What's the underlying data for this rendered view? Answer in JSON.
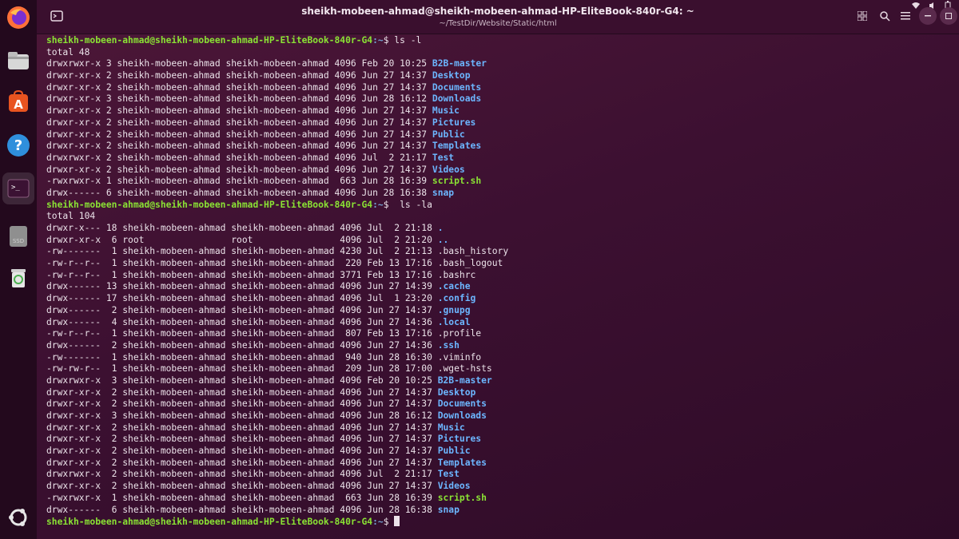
{
  "window": {
    "title": "sheikh-mobeen-ahmad@sheikh-mobeen-ahmad-HP-EliteBook-840r-G4: ~",
    "subtitle": "~/TestDir/Website/Static/html"
  },
  "dock": {
    "items": [
      {
        "name": "firefox-icon"
      },
      {
        "name": "files-icon"
      },
      {
        "name": "software-icon"
      },
      {
        "name": "help-icon"
      },
      {
        "name": "terminal-icon"
      },
      {
        "name": "drive-icon",
        "label": "SSD"
      },
      {
        "name": "trash-icon"
      },
      {
        "name": "ubuntu-logo-icon"
      }
    ]
  },
  "colors": {
    "prompt_user": "#8ae234",
    "prompt_path": "#729fcf",
    "directory": "#6cb6ff",
    "executable": "#8ae234",
    "text": "#ece3ea",
    "background": "#3c1031"
  },
  "terminal": {
    "prompt_user": "sheikh-mobeen-ahmad@sheikh-mobeen-ahmad-HP-EliteBook-840r-G4",
    "prompt_path": ":~",
    "commands": [
      {
        "command": "$ ls -l",
        "total": "total 48",
        "entries": [
          {
            "meta": "drwxrwxr-x 3 sheikh-mobeen-ahmad sheikh-mobeen-ahmad 4096 Feb 20 10:25 ",
            "name": "B2B-master",
            "kind": "dir"
          },
          {
            "meta": "drwxr-xr-x 2 sheikh-mobeen-ahmad sheikh-mobeen-ahmad 4096 Jun 27 14:37 ",
            "name": "Desktop",
            "kind": "dir"
          },
          {
            "meta": "drwxr-xr-x 2 sheikh-mobeen-ahmad sheikh-mobeen-ahmad 4096 Jun 27 14:37 ",
            "name": "Documents",
            "kind": "dir"
          },
          {
            "meta": "drwxr-xr-x 3 sheikh-mobeen-ahmad sheikh-mobeen-ahmad 4096 Jun 28 16:12 ",
            "name": "Downloads",
            "kind": "dir"
          },
          {
            "meta": "drwxr-xr-x 2 sheikh-mobeen-ahmad sheikh-mobeen-ahmad 4096 Jun 27 14:37 ",
            "name": "Music",
            "kind": "dir"
          },
          {
            "meta": "drwxr-xr-x 2 sheikh-mobeen-ahmad sheikh-mobeen-ahmad 4096 Jun 27 14:37 ",
            "name": "Pictures",
            "kind": "dir"
          },
          {
            "meta": "drwxr-xr-x 2 sheikh-mobeen-ahmad sheikh-mobeen-ahmad 4096 Jun 27 14:37 ",
            "name": "Public",
            "kind": "dir"
          },
          {
            "meta": "drwxr-xr-x 2 sheikh-mobeen-ahmad sheikh-mobeen-ahmad 4096 Jun 27 14:37 ",
            "name": "Templates",
            "kind": "dir"
          },
          {
            "meta": "drwxrwxr-x 2 sheikh-mobeen-ahmad sheikh-mobeen-ahmad 4096 Jul  2 21:17 ",
            "name": "Test",
            "kind": "dir"
          },
          {
            "meta": "drwxr-xr-x 2 sheikh-mobeen-ahmad sheikh-mobeen-ahmad 4096 Jun 27 14:37 ",
            "name": "Videos",
            "kind": "dir"
          },
          {
            "meta": "-rwxrwxr-x 1 sheikh-mobeen-ahmad sheikh-mobeen-ahmad  663 Jun 28 16:39 ",
            "name": "script.sh",
            "kind": "exec"
          },
          {
            "meta": "drwx------ 6 sheikh-mobeen-ahmad sheikh-mobeen-ahmad 4096 Jun 28 16:38 ",
            "name": "snap",
            "kind": "dir"
          }
        ]
      },
      {
        "command": "$  ls -la",
        "total": "total 104",
        "entries": [
          {
            "meta": "drwxr-x--- 18 sheikh-mobeen-ahmad sheikh-mobeen-ahmad 4096 Jul  2 21:18 ",
            "name": ".",
            "kind": "dir"
          },
          {
            "meta": "drwxr-xr-x  6 root                root                4096 Jul  2 21:20 ",
            "name": "..",
            "kind": "dir"
          },
          {
            "meta": "-rw-------  1 sheikh-mobeen-ahmad sheikh-mobeen-ahmad 4230 Jul  2 21:13 ",
            "name": ".bash_history",
            "kind": "file"
          },
          {
            "meta": "-rw-r--r--  1 sheikh-mobeen-ahmad sheikh-mobeen-ahmad  220 Feb 13 17:16 ",
            "name": ".bash_logout",
            "kind": "file"
          },
          {
            "meta": "-rw-r--r--  1 sheikh-mobeen-ahmad sheikh-mobeen-ahmad 3771 Feb 13 17:16 ",
            "name": ".bashrc",
            "kind": "file"
          },
          {
            "meta": "drwx------ 13 sheikh-mobeen-ahmad sheikh-mobeen-ahmad 4096 Jun 27 14:39 ",
            "name": ".cache",
            "kind": "dir"
          },
          {
            "meta": "drwx------ 17 sheikh-mobeen-ahmad sheikh-mobeen-ahmad 4096 Jul  1 23:20 ",
            "name": ".config",
            "kind": "dir"
          },
          {
            "meta": "drwx------  2 sheikh-mobeen-ahmad sheikh-mobeen-ahmad 4096 Jun 27 14:37 ",
            "name": ".gnupg",
            "kind": "dir"
          },
          {
            "meta": "drwx------  4 sheikh-mobeen-ahmad sheikh-mobeen-ahmad 4096 Jun 27 14:36 ",
            "name": ".local",
            "kind": "dir"
          },
          {
            "meta": "-rw-r--r--  1 sheikh-mobeen-ahmad sheikh-mobeen-ahmad  807 Feb 13 17:16 ",
            "name": ".profile",
            "kind": "file"
          },
          {
            "meta": "drwx------  2 sheikh-mobeen-ahmad sheikh-mobeen-ahmad 4096 Jun 27 14:36 ",
            "name": ".ssh",
            "kind": "dir"
          },
          {
            "meta": "-rw-------  1 sheikh-mobeen-ahmad sheikh-mobeen-ahmad  940 Jun 28 16:30 ",
            "name": ".viminfo",
            "kind": "file"
          },
          {
            "meta": "-rw-rw-r--  1 sheikh-mobeen-ahmad sheikh-mobeen-ahmad  209 Jun 28 17:00 ",
            "name": ".wget-hsts",
            "kind": "file"
          },
          {
            "meta": "drwxrwxr-x  3 sheikh-mobeen-ahmad sheikh-mobeen-ahmad 4096 Feb 20 10:25 ",
            "name": "B2B-master",
            "kind": "dir"
          },
          {
            "meta": "drwxr-xr-x  2 sheikh-mobeen-ahmad sheikh-mobeen-ahmad 4096 Jun 27 14:37 ",
            "name": "Desktop",
            "kind": "dir"
          },
          {
            "meta": "drwxr-xr-x  2 sheikh-mobeen-ahmad sheikh-mobeen-ahmad 4096 Jun 27 14:37 ",
            "name": "Documents",
            "kind": "dir"
          },
          {
            "meta": "drwxr-xr-x  3 sheikh-mobeen-ahmad sheikh-mobeen-ahmad 4096 Jun 28 16:12 ",
            "name": "Downloads",
            "kind": "dir"
          },
          {
            "meta": "drwxr-xr-x  2 sheikh-mobeen-ahmad sheikh-mobeen-ahmad 4096 Jun 27 14:37 ",
            "name": "Music",
            "kind": "dir"
          },
          {
            "meta": "drwxr-xr-x  2 sheikh-mobeen-ahmad sheikh-mobeen-ahmad 4096 Jun 27 14:37 ",
            "name": "Pictures",
            "kind": "dir"
          },
          {
            "meta": "drwxr-xr-x  2 sheikh-mobeen-ahmad sheikh-mobeen-ahmad 4096 Jun 27 14:37 ",
            "name": "Public",
            "kind": "dir"
          },
          {
            "meta": "drwxr-xr-x  2 sheikh-mobeen-ahmad sheikh-mobeen-ahmad 4096 Jun 27 14:37 ",
            "name": "Templates",
            "kind": "dir"
          },
          {
            "meta": "drwxrwxr-x  2 sheikh-mobeen-ahmad sheikh-mobeen-ahmad 4096 Jul  2 21:17 ",
            "name": "Test",
            "kind": "dir"
          },
          {
            "meta": "drwxr-xr-x  2 sheikh-mobeen-ahmad sheikh-mobeen-ahmad 4096 Jun 27 14:37 ",
            "name": "Videos",
            "kind": "dir"
          },
          {
            "meta": "-rwxrwxr-x  1 sheikh-mobeen-ahmad sheikh-mobeen-ahmad  663 Jun 28 16:39 ",
            "name": "script.sh",
            "kind": "exec"
          },
          {
            "meta": "drwx------  6 sheikh-mobeen-ahmad sheikh-mobeen-ahmad 4096 Jun 28 16:38 ",
            "name": "snap",
            "kind": "dir"
          }
        ]
      }
    ],
    "final_prompt_suffix": "$ "
  }
}
